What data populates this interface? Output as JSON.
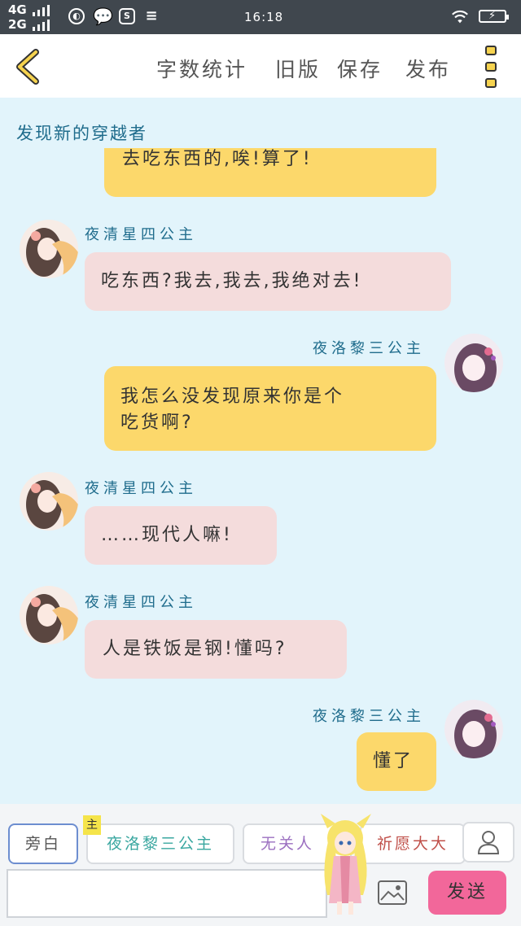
{
  "status": {
    "network_top": "4G",
    "network_bottom": "2G",
    "time": "16:18"
  },
  "toolbar": {
    "word_count": "字数统计",
    "old_version": "旧版",
    "save": "保存",
    "publish": "发布"
  },
  "chat": {
    "title": "发现新的穿越者",
    "messages": [
      {
        "side": "right",
        "text": "去吃东西的,唉!算了!"
      },
      {
        "side": "left",
        "name": "夜清星四公主",
        "text": "吃东西?我去,我去,我绝对去!"
      },
      {
        "side": "right",
        "name": "夜洛黎三公主",
        "text_line1": "我怎么没发现原来你是个",
        "text_line2": "吃货啊?"
      },
      {
        "side": "left",
        "name": "夜清星四公主",
        "text": "……现代人嘛!"
      },
      {
        "side": "left",
        "name": "夜清星四公主",
        "text": "人是铁饭是钢!懂吗?"
      },
      {
        "side": "right",
        "name": "夜洛黎三公主",
        "text": "懂了"
      }
    ]
  },
  "bottom": {
    "narration": "旁白",
    "main_tag": "主",
    "role_main": "夜洛黎三公主",
    "role_other": "无关人",
    "role_author": "祈愿大大",
    "input_value": "",
    "send": "发送"
  },
  "colors": {
    "status_bg": "#40474e",
    "chat_bg": "#e2f4fb",
    "right_bubble": "#fcd86b",
    "left_bubble": "#f4dcdc",
    "name_color": "#1f6c8c",
    "send_button": "#f2679a"
  },
  "icons": [
    "back-arrow-icon",
    "more-menu-icon",
    "image-icon",
    "user-icon",
    "wifi-icon",
    "battery-icon"
  ]
}
